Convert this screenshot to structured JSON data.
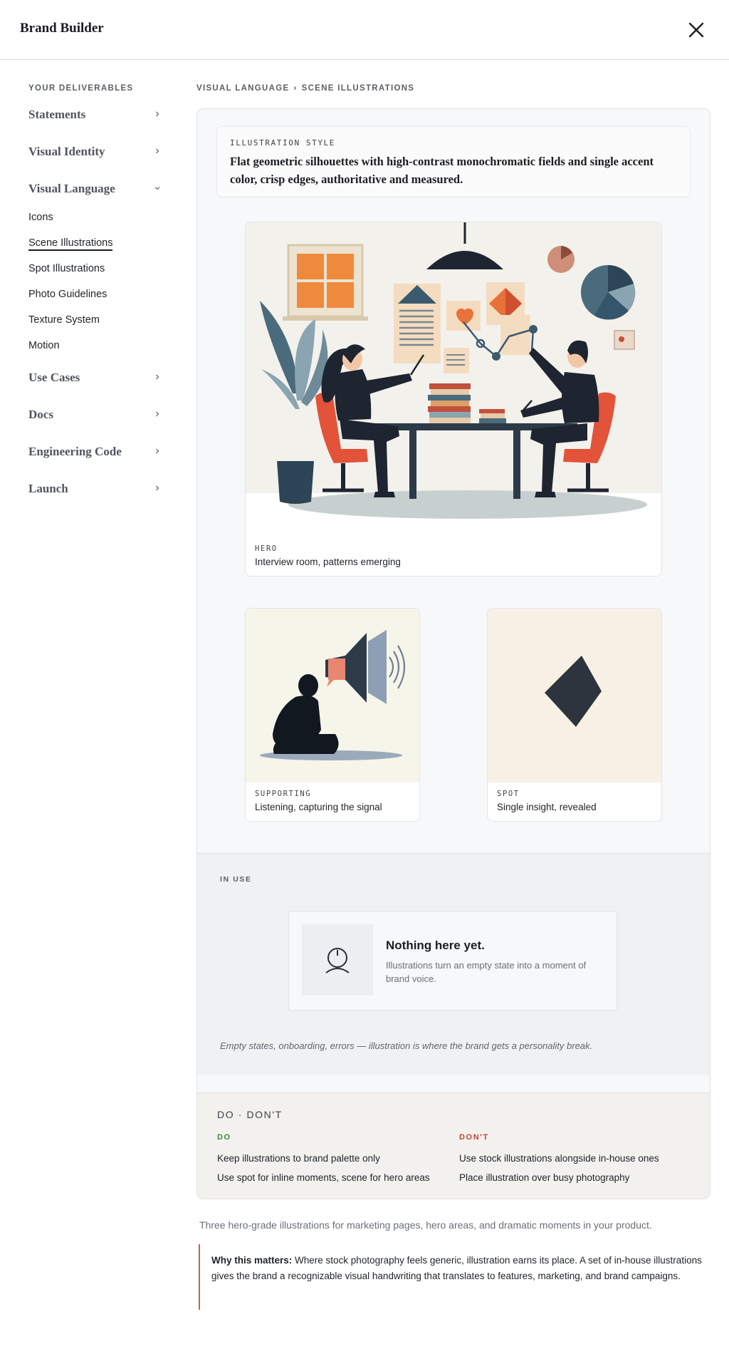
{
  "app": {
    "title": "Brand Builder",
    "close_icon": "close-icon"
  },
  "sidebar": {
    "heading": "YOUR DELIVERABLES",
    "sections": [
      {
        "label": "Statements",
        "expanded": false
      },
      {
        "label": "Visual Identity",
        "expanded": false
      },
      {
        "label": "Visual Language",
        "expanded": true
      },
      {
        "label": "Use Cases",
        "expanded": false
      },
      {
        "label": "Docs",
        "expanded": false
      },
      {
        "label": "Engineering Code",
        "expanded": false
      },
      {
        "label": "Launch",
        "expanded": false
      }
    ],
    "visual_language_items": [
      {
        "label": "Icons",
        "active": false
      },
      {
        "label": "Scene Illustrations",
        "active": true
      },
      {
        "label": "Spot Illustrations",
        "active": false
      },
      {
        "label": "Photo Guidelines",
        "active": false
      },
      {
        "label": "Texture System",
        "active": false
      },
      {
        "label": "Motion",
        "active": false
      }
    ]
  },
  "breadcrumb": {
    "parent": "VISUAL LANGUAGE",
    "separator": "›",
    "current": "SCENE ILLUSTRATIONS"
  },
  "illustration_style": {
    "kicker": "ILLUSTRATION STYLE",
    "description": "Flat geometric silhouettes with high-contrast monochromatic fields and single accent color, crisp edges, authoritative and measured."
  },
  "illustrations": {
    "hero": {
      "kicker": "HERO",
      "caption": "Interview room, patterns emerging"
    },
    "supporting": {
      "kicker": "SUPPORTING",
      "caption": "Listening, capturing the signal"
    },
    "spot": {
      "kicker": "SPOT",
      "caption": "Single insight, revealed"
    }
  },
  "in_use": {
    "kicker": "IN USE",
    "empty_title": "Nothing here yet.",
    "empty_subtitle": "Illustrations turn an empty state into a moment of brand voice.",
    "note": "Empty states, onboarding, errors — illustration is where the brand gets a personality break."
  },
  "do_dont": {
    "title": "DO · DON'T",
    "do_label": "DO",
    "dont_label": "DON'T",
    "do_items": [
      "Keep illustrations to brand palette only",
      "Use spot for inline moments, scene for hero areas"
    ],
    "dont_items": [
      "Use stock illustrations alongside in-house ones",
      "Place illustration over busy photography"
    ],
    "colors": {
      "do": "#3e8a3e",
      "dont": "#c0453a"
    }
  },
  "footer": {
    "intro": "Three hero-grade illustrations for marketing pages, hero areas, and dramatic moments in your product.",
    "callout_label": "Why this matters:",
    "callout_text": " Where stock photography feels generic, illustration earns its place. A set of in-house illustrations gives the brand a recognizable visual handwriting that translates to features, marketing, and brand campaigns."
  },
  "colors": {
    "accent": "#e2533a",
    "ink": "#1e2430",
    "teal": "#4a6b7c",
    "callout_border": "#b56a52"
  }
}
